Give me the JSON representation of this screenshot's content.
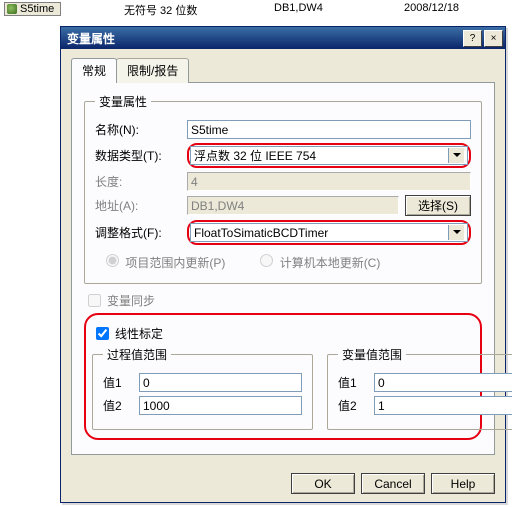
{
  "topbar": {
    "tag": "S5time",
    "datatype": "无符号 32 位数",
    "address": "DB1,DW4",
    "date": "2008/12/18"
  },
  "dialog": {
    "title": "变量属性",
    "tabs": {
      "general": "常规",
      "limits": "限制/报告"
    },
    "group_attrs": "变量属性",
    "labels": {
      "name": "名称(N):",
      "datatype": "数据类型(T):",
      "length": "长度:",
      "address": "地址(A):",
      "format": "调整格式(F):"
    },
    "values": {
      "name": "S5time",
      "datatype": "浮点数 32 位 IEEE 754",
      "length": "4",
      "address": "DB1,DW4",
      "format": "FloatToSimaticBCDTimer"
    },
    "buttons": {
      "select": "选择(S)",
      "ok": "OK",
      "cancel": "Cancel",
      "help": "Help"
    },
    "radios": {
      "project": "项目范围内更新(P)",
      "computer": "计算机本地更新(C)"
    },
    "checks": {
      "sync": "变量同步",
      "linear": "线性标定"
    },
    "groups": {
      "process": "过程值范围",
      "variable": "变量值范围"
    },
    "vlabels": {
      "v1": "值1",
      "v2": "值2"
    },
    "vvalues": {
      "p1": "0",
      "p2": "1000",
      "v1": "0",
      "v2": "1"
    }
  }
}
